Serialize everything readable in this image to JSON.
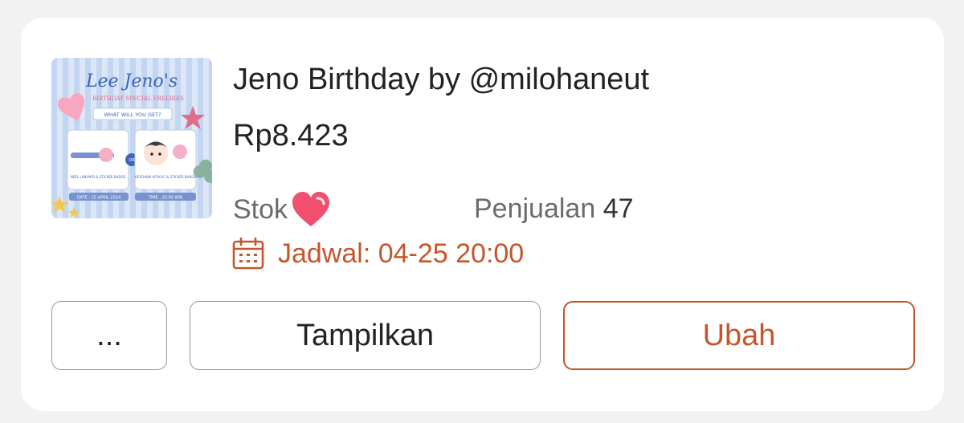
{
  "product": {
    "title": "Jeno Birthday by @milohaneut",
    "price": "Rp8.423",
    "stock_label": "Stok",
    "sales_label": "Penjualan",
    "sales_count": "47",
    "schedule": "Jadwal: 04-25 20:00",
    "thumbnail": {
      "heading": "Lee Jeno's",
      "subheading": "BIRTHDAY SPECIAL FREEBIES",
      "question": "WHAT WILL YOU GET?",
      "option_left": "NEEL LANYARD & STICKER BADGE",
      "option_right": "KEYCHAIN ACRYLIC & STICKER BADGE",
      "or_label": "OR",
      "date": "DATE : 25 APRIL 2024",
      "time": "TIME : 20.00 WIB"
    }
  },
  "actions": {
    "more_label": "...",
    "show_label": "Tampilkan",
    "edit_label": "Ubah"
  },
  "colors": {
    "accent": "#c5562c",
    "heart": "#f0506e",
    "card_bg": "#ffffff",
    "page_bg": "#f2f2f2"
  },
  "icons": {
    "stock": "heart-icon",
    "schedule": "calendar-icon"
  }
}
